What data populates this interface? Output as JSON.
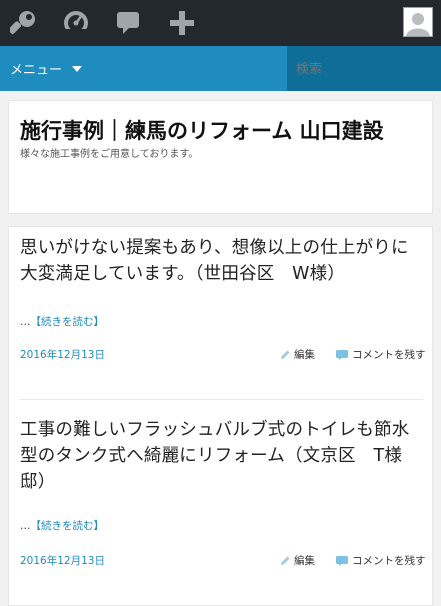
{
  "adminbar": {
    "icons": [
      "wrench-icon",
      "dashboard-icon",
      "comment-bubble-icon",
      "plus-icon"
    ],
    "avatar": "avatar-icon"
  },
  "menubar": {
    "menu_label": "メニュー",
    "search_placeholder": "検索"
  },
  "header": {
    "title": "施行事例｜練馬のリフォーム 山口建設",
    "description": "様々な施工事例をご用意しております。"
  },
  "posts": [
    {
      "title": "思いがけない提案もあり、想像以上の仕上がりに大変満足しています。（世田谷区　W様）",
      "more_prefix": "…",
      "more_label": "【続きを読む】",
      "date": "2016年12月13日",
      "edit_label": "編集",
      "comment_label": "コメントを残す"
    },
    {
      "title": "工事の難しいフラッシュバルブ式のトイレも節水型のタンク式へ綺麗にリフォーム（文京区　T様邸）",
      "more_prefix": "…",
      "more_label": "【続きを読む】",
      "date": "2016年12月13日",
      "edit_label": "編集",
      "comment_label": "コメントを残す"
    }
  ],
  "colors": {
    "adminbar": "#23282d",
    "menubar": "#1e8cbe",
    "search": "#0e6e98",
    "link": "#1e8cbe"
  }
}
